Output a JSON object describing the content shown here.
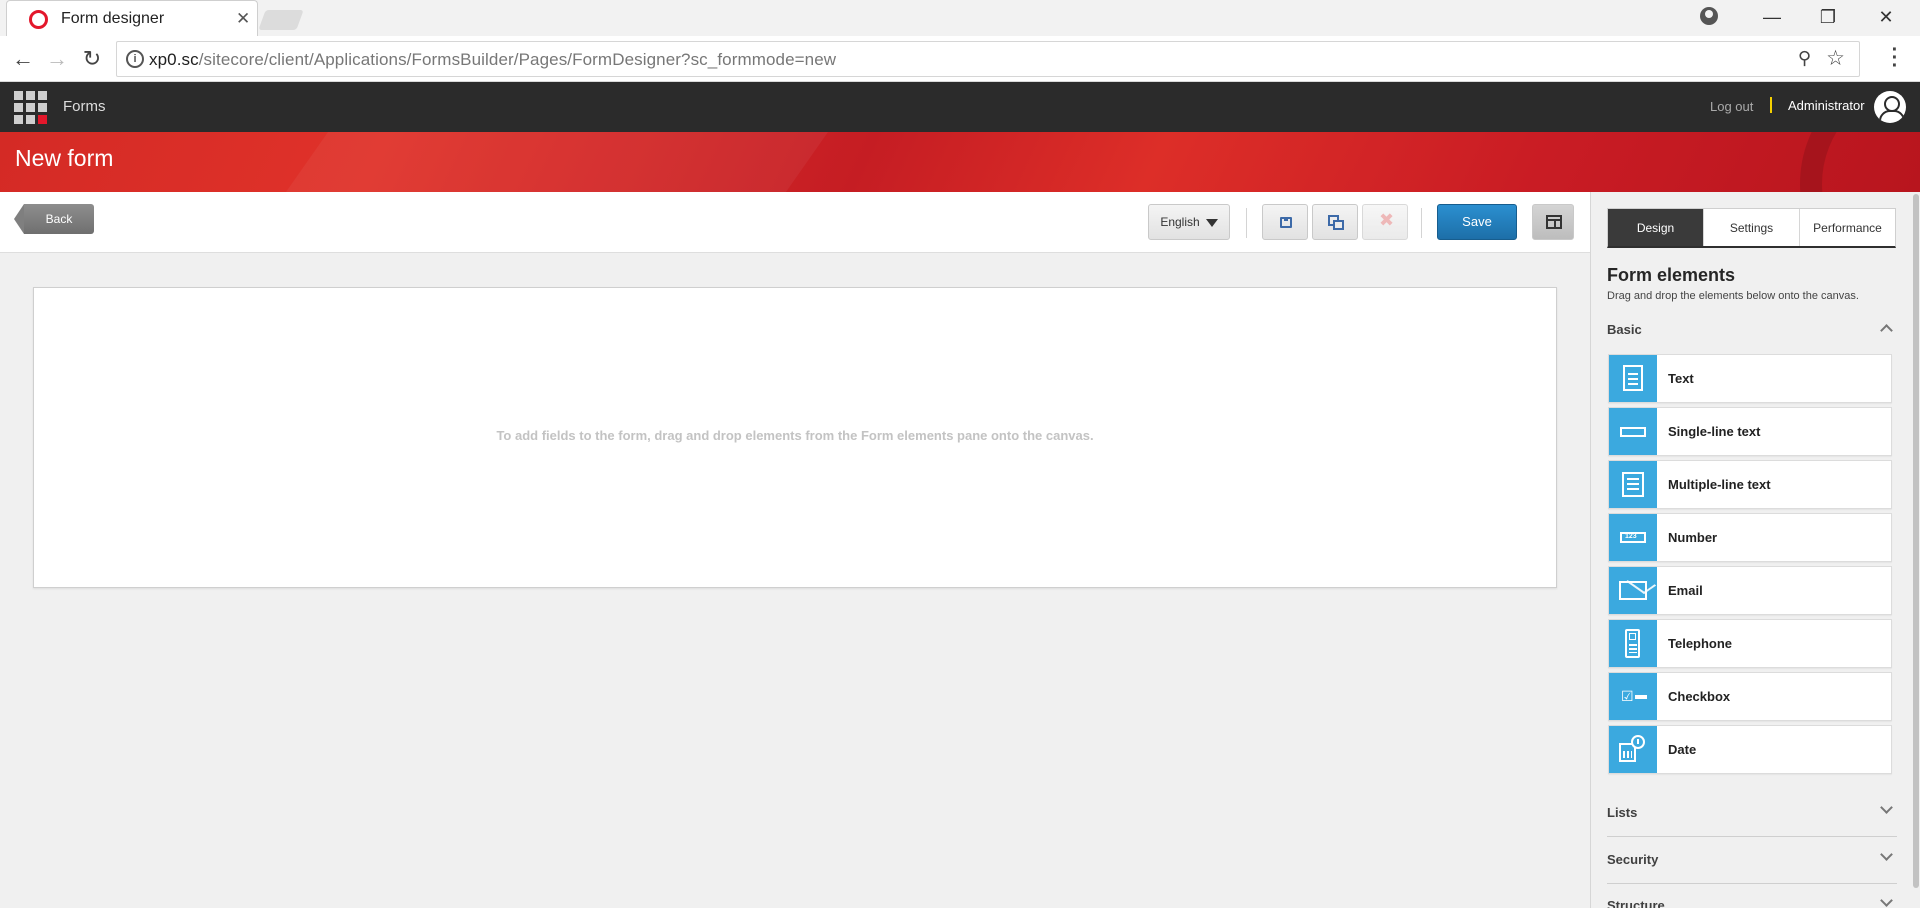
{
  "browser": {
    "tab_title": "Form designer",
    "url_host": "xp0.sc",
    "url_path": "/sitecore/client/Applications/FormsBuilder/Pages/FormDesigner?sc_formmode=new"
  },
  "appbar": {
    "app_name": "Forms",
    "logout_label": "Log out",
    "user_name": "Administrator"
  },
  "header": {
    "title": "New form"
  },
  "actions": {
    "back_label": "Back",
    "language": "English",
    "save_label": "Save"
  },
  "canvas": {
    "hint": "To add fields to the form, drag and drop elements from the Form elements pane onto the canvas."
  },
  "panel": {
    "tabs": [
      {
        "label": "Design"
      },
      {
        "label": "Settings"
      },
      {
        "label": "Performance"
      }
    ],
    "title": "Form elements",
    "subtitle": "Drag and drop the elements below onto the canvas.",
    "sections": {
      "basic": "Basic",
      "lists": "Lists",
      "security": "Security",
      "structure": "Structure"
    },
    "elements": [
      {
        "label": "Text",
        "icon": "text-document-icon"
      },
      {
        "label": "Single-line text",
        "icon": "single-line-text-icon"
      },
      {
        "label": "Multiple-line text",
        "icon": "multi-line-text-icon"
      },
      {
        "label": "Number",
        "icon": "number-icon"
      },
      {
        "label": "Email",
        "icon": "envelope-icon"
      },
      {
        "label": "Telephone",
        "icon": "phone-icon"
      },
      {
        "label": "Checkbox",
        "icon": "checkbox-icon"
      },
      {
        "label": "Date",
        "icon": "calendar-clock-icon"
      }
    ]
  },
  "colors": {
    "accent_red": "#e3172b",
    "element_icon_blue": "#3ba9df",
    "save_blue": "#1d6fa8"
  }
}
